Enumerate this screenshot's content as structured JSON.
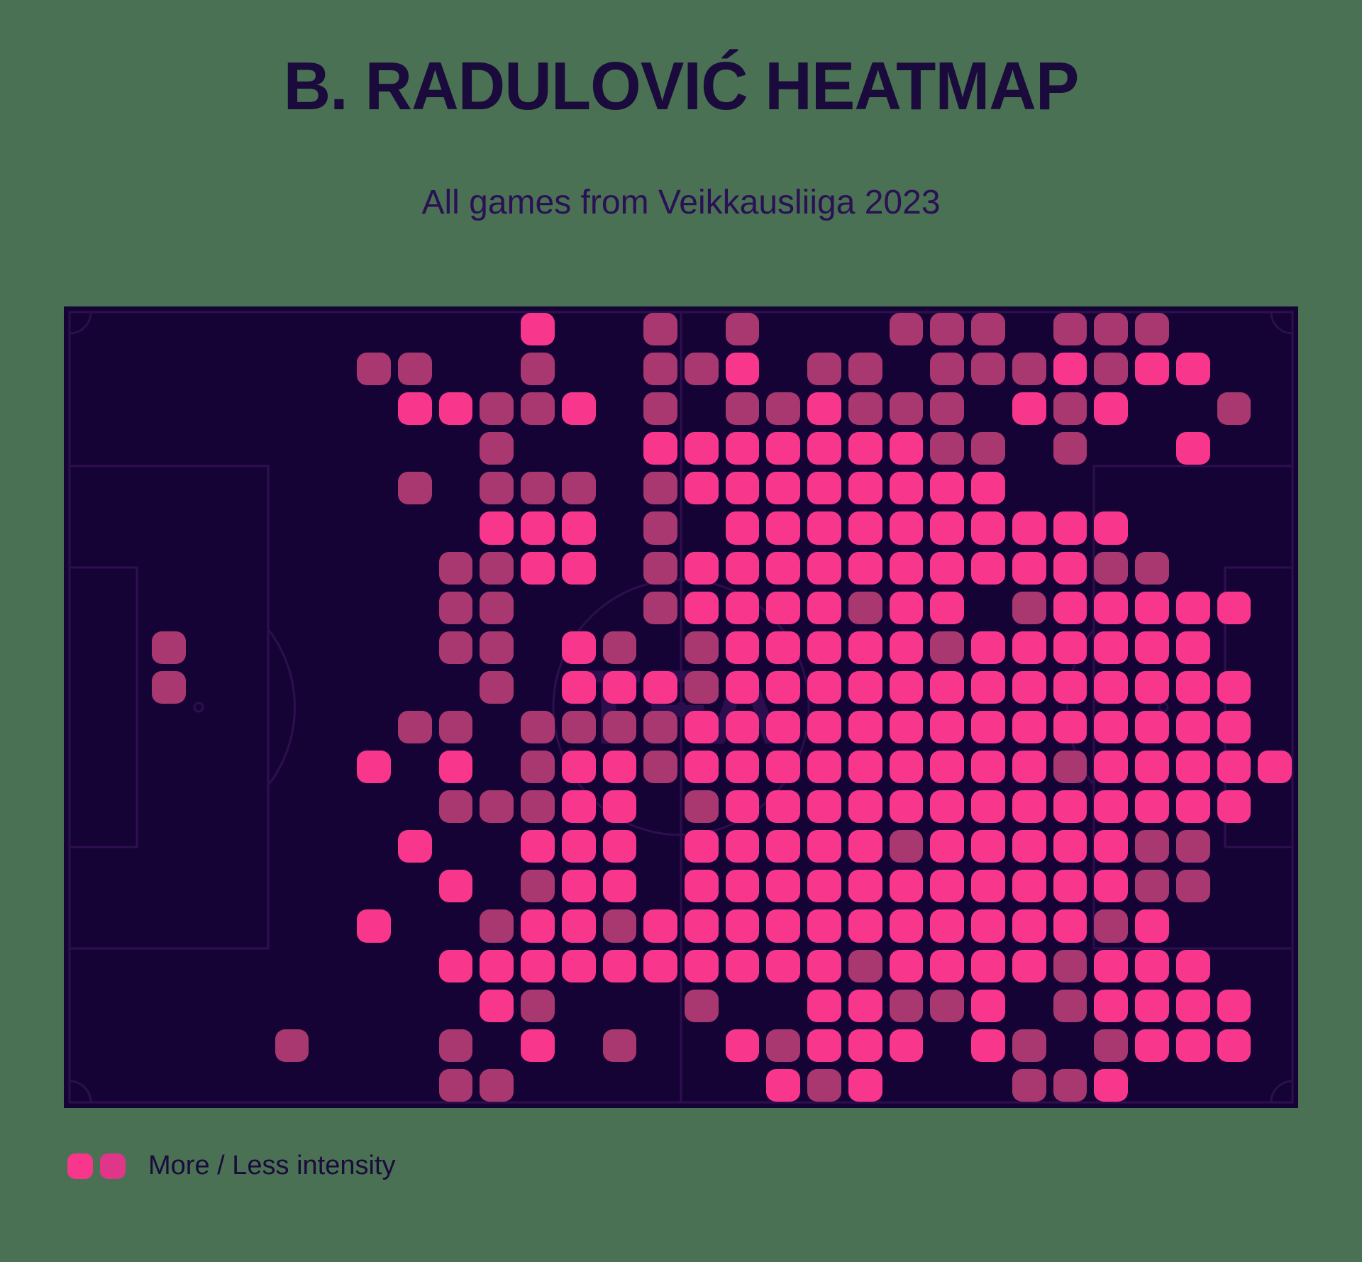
{
  "header": {
    "title": "B. RADULOVIĆ HEATMAP",
    "subtitle": "All games from Veikkausliiga 2023"
  },
  "legend": {
    "label": "More / Less intensity",
    "more_color": "#f7368c",
    "less_color": "#e0368a"
  },
  "pitch": {
    "background_color": "#150336",
    "line_color": "#2e0f4e",
    "page_background": "#4a7153",
    "watermark": "TFA"
  },
  "chart_data": {
    "type": "heatmap",
    "title": "B. RADULOVIĆ HEATMAP",
    "subtitle": "All games from Veikkausliiga 2023",
    "xlabel": "",
    "ylabel": "",
    "legend": [
      "More / Less intensity"
    ],
    "grid": {
      "cols": 30,
      "rows": 20
    },
    "colorscale": [
      {
        "level": 0,
        "name": "none",
        "color": "transparent"
      },
      {
        "level": 1,
        "name": "less",
        "color": "#a8386f"
      },
      {
        "level": 2,
        "name": "medium",
        "color": "#d83a80"
      },
      {
        "level": 3,
        "name": "more",
        "color": "#f7368c"
      }
    ],
    "orientation": "attacking-right",
    "notes": "Football pitch heatmap; activity concentrated in the right (attacking) half and central/right midfield zones.",
    "values": [
      [
        0,
        0,
        0,
        0,
        0,
        0,
        0,
        0,
        0,
        0,
        0,
        3,
        0,
        0,
        1,
        0,
        1,
        0,
        0,
        0,
        1,
        1,
        1,
        0,
        1,
        1,
        1,
        0,
        0,
        0
      ],
      [
        0,
        0,
        0,
        0,
        0,
        0,
        0,
        1,
        1,
        0,
        0,
        1,
        0,
        0,
        1,
        1,
        3,
        0,
        1,
        1,
        0,
        1,
        1,
        1,
        3,
        1,
        3,
        3,
        0,
        0
      ],
      [
        0,
        0,
        0,
        0,
        0,
        0,
        0,
        0,
        3,
        3,
        1,
        1,
        3,
        0,
        1,
        0,
        1,
        1,
        3,
        1,
        1,
        1,
        0,
        3,
        1,
        3,
        0,
        0,
        1,
        0
      ],
      [
        0,
        0,
        0,
        0,
        0,
        0,
        0,
        0,
        0,
        0,
        1,
        0,
        0,
        0,
        3,
        3,
        3,
        3,
        3,
        3,
        3,
        1,
        1,
        0,
        1,
        0,
        0,
        3,
        0,
        0
      ],
      [
        0,
        0,
        0,
        0,
        0,
        0,
        0,
        0,
        1,
        0,
        1,
        1,
        1,
        0,
        1,
        3,
        3,
        3,
        3,
        3,
        3,
        3,
        3,
        0,
        0,
        0,
        0,
        0,
        0,
        0
      ],
      [
        0,
        0,
        0,
        0,
        0,
        0,
        0,
        0,
        0,
        0,
        3,
        3,
        3,
        0,
        1,
        0,
        3,
        3,
        3,
        3,
        3,
        3,
        3,
        3,
        3,
        3,
        0,
        0,
        0,
        0
      ],
      [
        0,
        0,
        0,
        0,
        0,
        0,
        0,
        0,
        0,
        1,
        1,
        3,
        3,
        0,
        1,
        3,
        3,
        3,
        3,
        3,
        3,
        3,
        3,
        3,
        3,
        1,
        1,
        0,
        0,
        0
      ],
      [
        0,
        0,
        0,
        0,
        0,
        0,
        0,
        0,
        0,
        1,
        1,
        0,
        0,
        0,
        1,
        3,
        3,
        3,
        3,
        1,
        3,
        3,
        0,
        1,
        3,
        3,
        3,
        3,
        3,
        0
      ],
      [
        0,
        0,
        1,
        0,
        0,
        0,
        0,
        0,
        0,
        1,
        1,
        0,
        3,
        1,
        0,
        1,
        3,
        3,
        3,
        3,
        3,
        1,
        3,
        3,
        3,
        3,
        3,
        3,
        0,
        0
      ],
      [
        0,
        0,
        1,
        0,
        0,
        0,
        0,
        0,
        0,
        0,
        1,
        0,
        3,
        3,
        3,
        1,
        3,
        3,
        3,
        3,
        3,
        3,
        3,
        3,
        3,
        3,
        3,
        3,
        3,
        0
      ],
      [
        0,
        0,
        0,
        0,
        0,
        0,
        0,
        0,
        1,
        1,
        0,
        1,
        1,
        1,
        1,
        3,
        3,
        3,
        3,
        3,
        3,
        3,
        3,
        3,
        3,
        3,
        3,
        3,
        3,
        0
      ],
      [
        0,
        0,
        0,
        0,
        0,
        0,
        0,
        3,
        0,
        3,
        0,
        1,
        3,
        3,
        1,
        3,
        3,
        3,
        3,
        3,
        3,
        3,
        3,
        3,
        1,
        3,
        3,
        3,
        3,
        3
      ],
      [
        0,
        0,
        0,
        0,
        0,
        0,
        0,
        0,
        0,
        1,
        1,
        1,
        3,
        3,
        0,
        1,
        3,
        3,
        3,
        3,
        3,
        3,
        3,
        3,
        3,
        3,
        3,
        3,
        3,
        0
      ],
      [
        0,
        0,
        0,
        0,
        0,
        0,
        0,
        0,
        3,
        0,
        0,
        3,
        3,
        3,
        0,
        3,
        3,
        3,
        3,
        3,
        1,
        3,
        3,
        3,
        3,
        3,
        1,
        1,
        0,
        0
      ],
      [
        0,
        0,
        0,
        0,
        0,
        0,
        0,
        0,
        0,
        3,
        0,
        1,
        3,
        3,
        0,
        3,
        3,
        3,
        3,
        3,
        3,
        3,
        3,
        3,
        3,
        3,
        1,
        1,
        0,
        0
      ],
      [
        0,
        0,
        0,
        0,
        0,
        0,
        0,
        3,
        0,
        0,
        1,
        3,
        3,
        1,
        3,
        3,
        3,
        3,
        3,
        3,
        3,
        3,
        3,
        3,
        3,
        1,
        3,
        0,
        0,
        0
      ],
      [
        0,
        0,
        0,
        0,
        0,
        0,
        0,
        0,
        0,
        3,
        3,
        3,
        3,
        3,
        3,
        3,
        3,
        3,
        3,
        1,
        3,
        3,
        3,
        3,
        1,
        3,
        3,
        3,
        0,
        0
      ],
      [
        0,
        0,
        0,
        0,
        0,
        0,
        0,
        0,
        0,
        0,
        3,
        1,
        0,
        0,
        0,
        1,
        0,
        0,
        3,
        3,
        1,
        1,
        3,
        0,
        1,
        3,
        3,
        3,
        3,
        0
      ],
      [
        0,
        0,
        0,
        0,
        0,
        1,
        0,
        0,
        0,
        1,
        0,
        3,
        0,
        1,
        0,
        0,
        3,
        1,
        3,
        3,
        3,
        0,
        3,
        1,
        0,
        1,
        3,
        3,
        3,
        0
      ],
      [
        0,
        0,
        0,
        0,
        0,
        0,
        0,
        0,
        0,
        1,
        1,
        0,
        0,
        0,
        0,
        0,
        0,
        3,
        1,
        3,
        0,
        0,
        0,
        1,
        1,
        3,
        0,
        0,
        0,
        0
      ]
    ]
  }
}
